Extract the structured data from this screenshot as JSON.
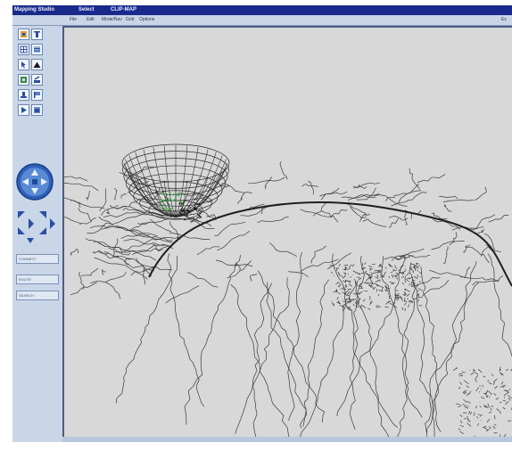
{
  "window": {
    "title": "Mapping Studio",
    "title_segments": [
      "Select",
      "CLIP-MAP"
    ]
  },
  "menu": {
    "items": [
      "File",
      "Edit",
      "Mode/Nav",
      "Grid",
      "Options"
    ],
    "right_label": "Ex"
  },
  "toolbar": {
    "buttons": [
      {
        "name": "layers-tool",
        "icon": "layers-icon"
      },
      {
        "name": "info-tool",
        "icon": "info-icon"
      },
      {
        "name": "grid-tool",
        "icon": "grid-icon"
      },
      {
        "name": "table-tool",
        "icon": "table-icon"
      },
      {
        "name": "pointer-tool",
        "icon": "pointer-icon"
      },
      {
        "name": "terrain-tool",
        "icon": "mountain-icon"
      },
      {
        "name": "map-tool",
        "icon": "map-icon"
      },
      {
        "name": "draw-tool",
        "icon": "pencil-icon"
      },
      {
        "name": "rotate-tool",
        "icon": "rotate-icon"
      },
      {
        "name": "flag-tool",
        "icon": "flag-icon"
      },
      {
        "name": "play-tool",
        "icon": "play-icon"
      },
      {
        "name": "window-tool",
        "icon": "window-icon"
      }
    ],
    "fields": [
      "CONNECT",
      "ROUTE",
      "SEARCH"
    ]
  },
  "colors": {
    "titlebar": "#1a2a8c",
    "panel": "#c9d6e8",
    "viewport": "#d8d8d8",
    "roads": "#3a3a3a",
    "highway": "#1e1e1e",
    "dome": "#2b2b2b",
    "highlight": "#2fbf3a"
  }
}
